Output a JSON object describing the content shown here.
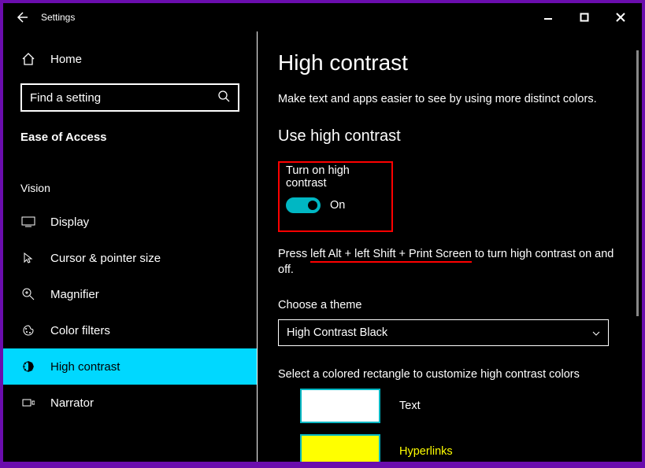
{
  "titlebar": {
    "title": "Settings"
  },
  "sidebar": {
    "home_label": "Home",
    "search_placeholder": "Find a setting",
    "category": "Ease of Access",
    "group": "Vision",
    "items": [
      {
        "icon": "display",
        "label": "Display"
      },
      {
        "icon": "cursor",
        "label": "Cursor & pointer size"
      },
      {
        "icon": "magnify",
        "label": "Magnifier"
      },
      {
        "icon": "palette",
        "label": "Color filters"
      },
      {
        "icon": "contrast",
        "label": "High contrast"
      },
      {
        "icon": "narrator",
        "label": "Narrator"
      }
    ]
  },
  "main": {
    "page_title": "High contrast",
    "page_desc": "Make text and apps easier to see by using more distinct colors.",
    "section_use": "Use high contrast",
    "toggle_label": "Turn on high contrast",
    "toggle_state": "On",
    "hint_pre": "Press ",
    "hint_keys": "left Alt + left Shift + Print Screen",
    "hint_post": " to turn high contrast on and off.",
    "choose_theme_label": "Choose a theme",
    "theme_selected": "High Contrast Black",
    "customize_label": "Select a colored rectangle to customize high contrast colors",
    "swatches": {
      "text": "Text",
      "hyperlinks": "Hyperlinks"
    }
  },
  "colors": {
    "accent": "#00b7c3",
    "toggle": "#00b7c3",
    "highlight_red": "#ff0000",
    "selection": "#00d8ff",
    "hyperlink": "#ffff00"
  }
}
